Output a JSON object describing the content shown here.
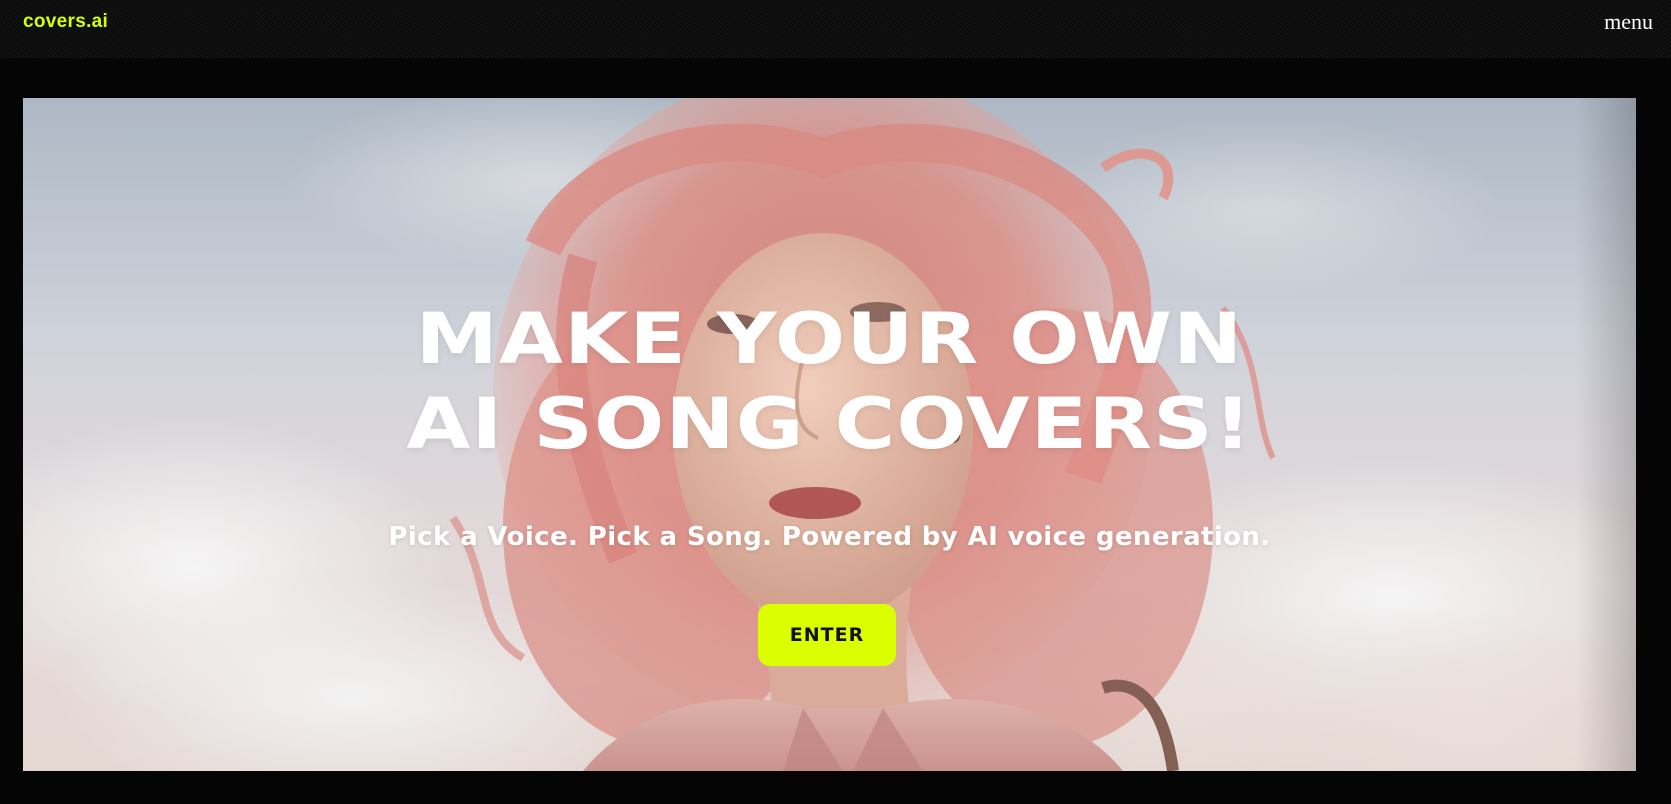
{
  "header": {
    "logo_text": "covers.ai",
    "menu_label": "menu"
  },
  "hero": {
    "headline_line1": "MAKE YOUR OWN",
    "headline_line2": "AI SONG COVERS!",
    "subtitle": "Pick a Voice. Pick a Song. Powered by AI voice generation.",
    "cta_label": "ENTER",
    "image_description_icon": "portrait-image"
  },
  "colors": {
    "accent": "#dcff00",
    "background": "#050505",
    "text": "#ffffff"
  }
}
